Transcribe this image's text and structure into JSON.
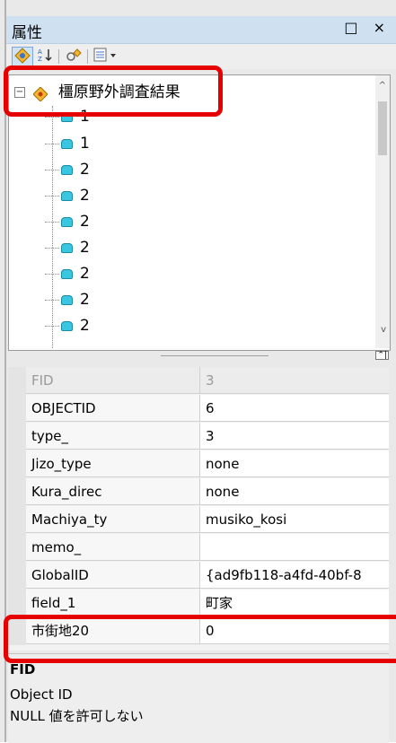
{
  "window": {
    "title": "属性",
    "buttons": "□ ×"
  },
  "toolbar": {
    "items": [
      "categorized-view-icon",
      "sort-alpha-icon",
      "property-pages-icon",
      "list-view-icon"
    ]
  },
  "tree": {
    "root_label": "橿原野外調査結果",
    "collapse_glyph": "−",
    "items": [
      "1",
      "1",
      "2",
      "2",
      "2",
      "2",
      "2",
      "2",
      "2"
    ]
  },
  "properties": {
    "rows": [
      {
        "name": "FID",
        "value": "3"
      },
      {
        "name": "OBJECTID",
        "value": "6"
      },
      {
        "name": "type_",
        "value": "3"
      },
      {
        "name": "Jizo_type",
        "value": "none"
      },
      {
        "name": "Kura_direc",
        "value": "none"
      },
      {
        "name": "Machiya_ty",
        "value": "musiko_kosi"
      },
      {
        "name": "memo_",
        "value": ""
      },
      {
        "name": "GlobalID",
        "value": "{ad9fb118-a4fd-40bf-8"
      },
      {
        "name": "field_1",
        "value": "町家"
      },
      {
        "name": "市街地20",
        "value": "0"
      }
    ]
  },
  "description": {
    "title": "FID",
    "line1": "Object ID",
    "line2": "NULL 値を許可しない"
  },
  "colors": {
    "highlight": "#e60000",
    "titlebar": "#cfe0f1",
    "feature_icon": "#39c6e0"
  }
}
